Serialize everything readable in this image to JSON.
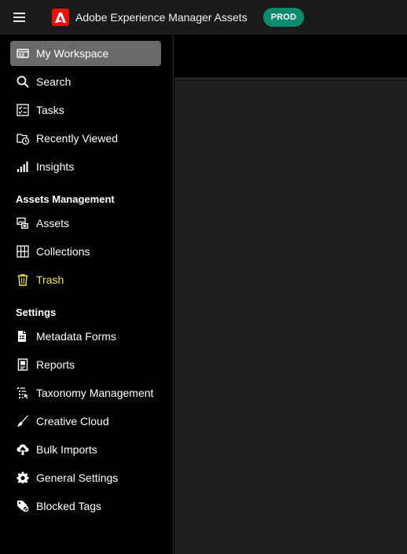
{
  "header": {
    "app_title": "Adobe Experience Manager Assets",
    "env_badge": "PROD",
    "logo_text": "A"
  },
  "colors": {
    "brand_red": "#eb1000",
    "env_badge_bg": "#0e8a6f",
    "trash_accent": "#f4e64a",
    "active_item_bg": "#6a6a6a"
  },
  "sidebar": {
    "workspace_items": [
      {
        "label": "My Workspace",
        "icon": "workspace-icon",
        "active": true
      },
      {
        "label": "Search",
        "icon": "search-icon"
      },
      {
        "label": "Tasks",
        "icon": "tasks-icon"
      },
      {
        "label": "Recently Viewed",
        "icon": "recently-viewed-icon"
      },
      {
        "label": "Insights",
        "icon": "insights-icon"
      }
    ],
    "assets_management": {
      "title": "Assets Management",
      "items": [
        {
          "label": "Assets",
          "icon": "assets-icon"
        },
        {
          "label": "Collections",
          "icon": "collections-icon"
        },
        {
          "label": "Trash",
          "icon": "trash-icon"
        }
      ]
    },
    "settings": {
      "title": "Settings",
      "items": [
        {
          "label": "Metadata Forms",
          "icon": "metadata-forms-icon"
        },
        {
          "label": "Reports",
          "icon": "reports-icon"
        },
        {
          "label": "Taxonomy Management",
          "icon": "taxonomy-icon"
        },
        {
          "label": "Creative Cloud",
          "icon": "creative-cloud-icon"
        },
        {
          "label": "Bulk Imports",
          "icon": "bulk-imports-icon"
        },
        {
          "label": "General Settings",
          "icon": "gear-icon"
        },
        {
          "label": "Blocked Tags",
          "icon": "blocked-tags-icon"
        }
      ]
    }
  }
}
